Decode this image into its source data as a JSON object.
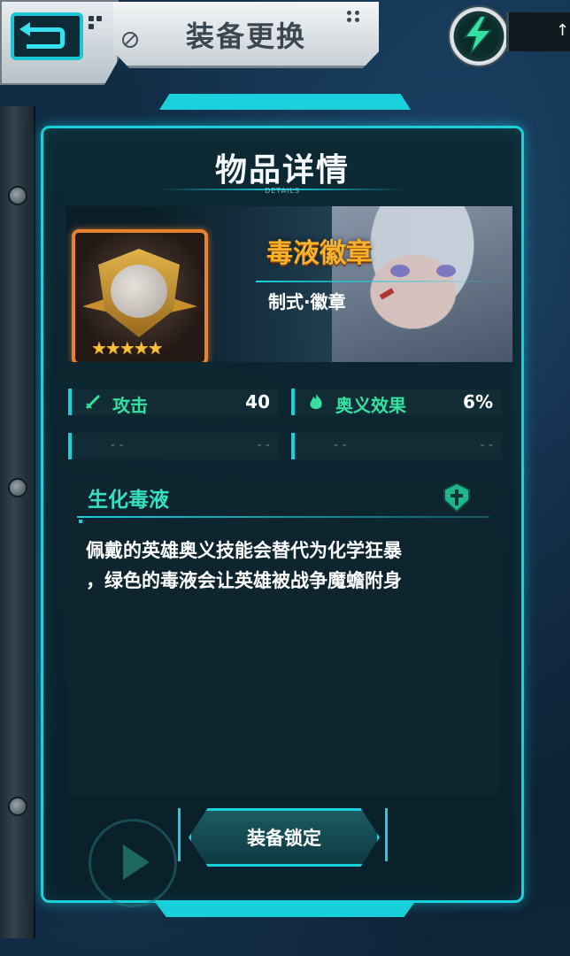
{
  "header": {
    "page_title": "装备更换",
    "top_right_text": "↑"
  },
  "panel": {
    "title": "物品详情",
    "subtitle_small": "DETAILS"
  },
  "item": {
    "name": "毒液徽章",
    "type": "制式·徽章",
    "rarity_stars": 5,
    "stars_text": "★★★★★"
  },
  "stats": [
    {
      "label": "攻击",
      "value": "40",
      "icon": "sword-icon"
    },
    {
      "label": "奥义效果",
      "value": "6%",
      "icon": "flame-icon"
    },
    {
      "left": "- -",
      "right": "- -"
    },
    {
      "left": "- -",
      "right": "- -"
    }
  ],
  "skill": {
    "title": "生化毒液",
    "description": "佩戴的英雄奥义技能会替代为化学狂暴，绿色的毒液会让英雄被战争魔蟾附身",
    "description_line1": "佩戴的英雄奥义技能会替代为化学狂暴",
    "description_line2": "，绿色的毒液会让英雄被战争魔蟾附身",
    "icon": "shield-icon"
  },
  "actions": {
    "lock_label": "装备锁定"
  },
  "colors": {
    "accent": "#19d0dc",
    "item_name": "#f7b12a",
    "stat_label": "#35e1a0",
    "rarity_frame": "#e9822e"
  }
}
